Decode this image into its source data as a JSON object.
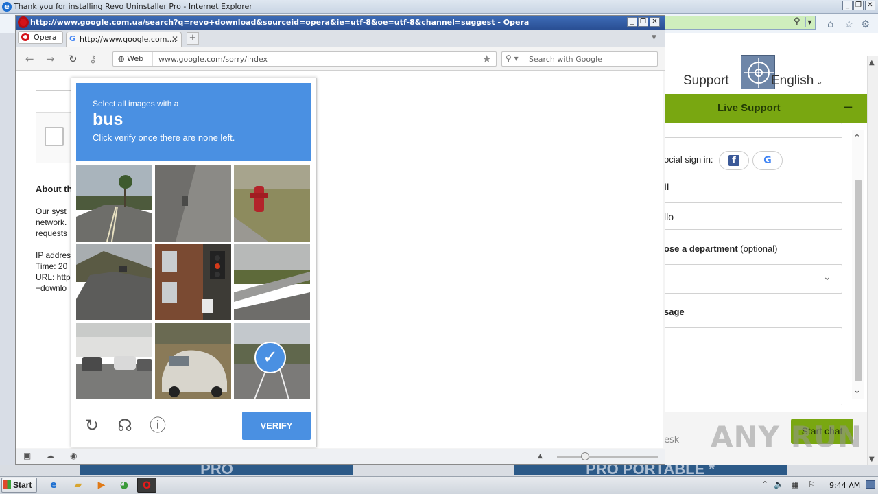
{
  "ie": {
    "title": "Thank you for installing Revo Uninstaller Pro - Internet Explorer",
    "nav_support": "Support",
    "nav_language": "English",
    "banner_left": "PRO",
    "banner_right": "PRO PORTABLE *"
  },
  "live_support": {
    "title": "Live Support",
    "social_label": "ocial sign in:",
    "email_label": "il",
    "email_value": "llo",
    "department_label": "ose a department",
    "department_optional": "(optional)",
    "message_label": "sage",
    "footer_left": "esk",
    "start_button": "Start chat"
  },
  "watermark": "ANY RUN",
  "opera": {
    "title": "http://www.google.com.ua/search?q=revo+download&sourceid=opera&ie=utf-8&oe=utf-8&channel=suggest - Opera",
    "menu_label": "Opera",
    "tab_title": "http://www.google.com....",
    "web_label": "Web",
    "url": "www.google.com/sorry/index",
    "search_placeholder": "Search with Google"
  },
  "google_sorry": {
    "about_heading": "About th",
    "lines": [
      "Our syst",
      "network.",
      "requests",
      "IP addres",
      "Time: 20",
      "URL: http",
      "+downlo"
    ]
  },
  "captcha": {
    "select_text": "Select all images with a",
    "target": "bus",
    "instruction": "Click verify once there are none left.",
    "verify_label": "VERIFY",
    "tiles": [
      {
        "subject": "road-with-palm-trees",
        "selected": false
      },
      {
        "subject": "gray-road-surface",
        "selected": false
      },
      {
        "subject": "red-fire-hydrant",
        "selected": false
      },
      {
        "subject": "highway-with-hills",
        "selected": false
      },
      {
        "subject": "traffic-light-building",
        "selected": false
      },
      {
        "subject": "bridge-guardrail",
        "selected": false
      },
      {
        "subject": "parking-lot-cars",
        "selected": false
      },
      {
        "subject": "white-car",
        "selected": false
      },
      {
        "subject": "street-with-vehicle",
        "selected": true
      }
    ]
  },
  "taskbar": {
    "start_label": "Start",
    "clock": "9:44 AM"
  },
  "colors": {
    "captcha_blue": "#4a90e2",
    "live_support_green": "#79a711",
    "opera_red": "#d4131a"
  }
}
